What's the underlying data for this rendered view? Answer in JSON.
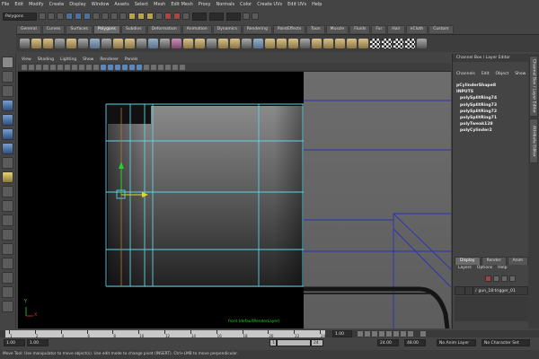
{
  "menubar": {
    "items": [
      "File",
      "Edit",
      "Modify",
      "Create",
      "Display",
      "Window",
      "Assets",
      "Select",
      "Mesh",
      "Edit Mesh",
      "Proxy",
      "Normals",
      "Color",
      "Create UVs",
      "Edit UVs",
      "Help"
    ]
  },
  "status": {
    "mode": "Polygons"
  },
  "shelf": {
    "tabs": [
      "General",
      "Curves",
      "Surfaces",
      "Polygons",
      "Subdivs",
      "Deformation",
      "Animation",
      "Dynamics",
      "Rendering",
      "PaintEffects",
      "Toon",
      "Muscle",
      "Fluids",
      "Fur",
      "Hair",
      "nCloth",
      "Custom"
    ],
    "active_tab": "Polygons"
  },
  "panel": {
    "menu": [
      "View",
      "Shading",
      "Lighting",
      "Show",
      "Renderer",
      "Panels"
    ],
    "camera_label": "front (defaultRenderLayer)"
  },
  "channel_box": {
    "header": "Channel Box / Layer Editor",
    "menu": [
      "Channels",
      "Edit",
      "Object",
      "Show"
    ],
    "shape": "pCylinderShape8",
    "inputs_label": "INPUTS",
    "inputs": [
      "polySplitRing74",
      "polySplitRing73",
      "polySplitRing72",
      "polySplitRing71",
      "polyTweak128",
      "polyCylinder2"
    ]
  },
  "side_tabs": {
    "tab1": "Channel Box / Layer Editor",
    "tab2": "Attribute Editor"
  },
  "layer_editor": {
    "tabs": [
      "Display",
      "Render",
      "Anim"
    ],
    "active_tab": "Display",
    "menu": [
      "Layers",
      "Options",
      "Help"
    ],
    "layer_name": "gun_18:trigger_01"
  },
  "timeline": {
    "ticks": [
      "1",
      "2",
      "4",
      "6",
      "8",
      "10",
      "12",
      "14",
      "16",
      "18",
      "20",
      "22",
      "24"
    ],
    "current_time": "1.00"
  },
  "range": {
    "start": "1.00",
    "inner_start": "1.00",
    "range_start": "1",
    "range_end": "24",
    "end": "24.00",
    "anim_end": "48.00",
    "anim_layer": "No Anim Layer",
    "char_set": "No Character Set"
  },
  "help_line": "Move Tool: Use manipulator to move object(s). Use edit mode to change pivot (INSERT). Ctrl+LMB to move perpendicular.",
  "axis": {
    "y": "Y",
    "x": "X"
  },
  "colors": {
    "wire": "#5fd3e6",
    "wire_blue": "#2a32b8"
  }
}
